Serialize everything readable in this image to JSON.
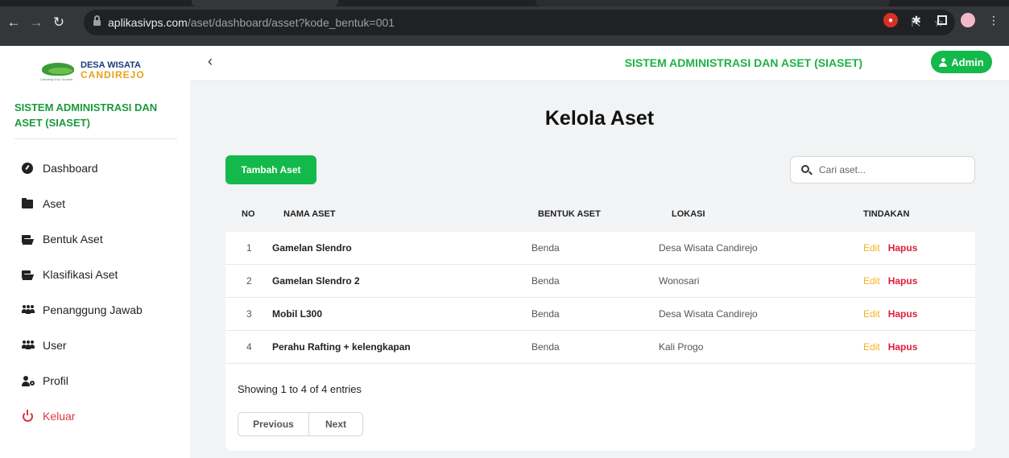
{
  "browser": {
    "url_host": "aplikasivps.com",
    "url_path": "/aset/dashboard/asset?kode_bentuk=001"
  },
  "brand": {
    "line1": "DESA WISATA",
    "line2": "CANDIREJO",
    "tagline": "Candirejo Eco Tourism"
  },
  "sidebar": {
    "title": "SISTEM ADMINISTRASI DAN ASET (SIASET)",
    "items": [
      {
        "label": "Dashboard",
        "icon": "dashboard-icon"
      },
      {
        "label": "Aset",
        "icon": "folder-icon"
      },
      {
        "label": "Bentuk Aset",
        "icon": "folder-open-icon"
      },
      {
        "label": "Klasifikasi Aset",
        "icon": "folder-open-icon"
      },
      {
        "label": "Penanggung Jawab",
        "icon": "users-icon"
      },
      {
        "label": "User",
        "icon": "users-icon"
      },
      {
        "label": "Profil",
        "icon": "user-cog-icon"
      },
      {
        "label": "Keluar",
        "icon": "power-icon"
      }
    ]
  },
  "header": {
    "title": "SISTEM ADMINISTRASI DAN ASET (SIASET)",
    "user_label": "Admin",
    "back_glyph": "‹"
  },
  "main": {
    "page_title": "Kelola Aset",
    "add_button": "Tambah Aset",
    "search_placeholder": "Cari aset...",
    "columns": [
      "NO",
      "NAMA ASET",
      "BENTUK ASET",
      "LOKASI",
      "TINDAKAN"
    ],
    "rows": [
      {
        "no": "1",
        "name": "Gamelan Slendro",
        "bentuk": "Benda",
        "lokasi": "Desa Wisata Candirejo"
      },
      {
        "no": "2",
        "name": "Gamelan Slendro 2",
        "bentuk": "Benda",
        "lokasi": "Wonosari"
      },
      {
        "no": "3",
        "name": "Mobil L300",
        "bentuk": "Benda",
        "lokasi": "Desa Wisata Candirejo"
      },
      {
        "no": "4",
        "name": "Perahu Rafting + kelengkapan",
        "bentuk": "Benda",
        "lokasi": "Kali Progo"
      }
    ],
    "edit_label": "Edit",
    "delete_label": "Hapus",
    "entries_text": "Showing 1 to 4 of 4 entries",
    "prev_label": "Previous",
    "next_label": "Next"
  },
  "colors": {
    "accent_green": "#13b94a",
    "edit_yellow": "#f5b21e",
    "delete_red": "#dc1f3c",
    "logout_red": "#dc3545"
  }
}
